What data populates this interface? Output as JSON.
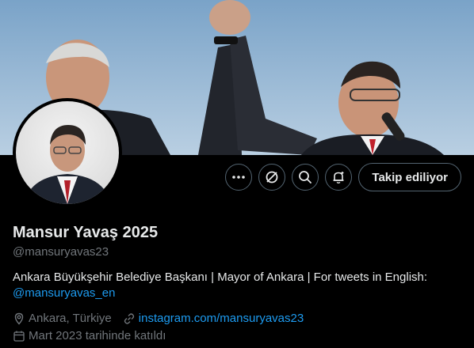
{
  "banner": {
    "description_icon": "banner-photo"
  },
  "profile": {
    "name": "Mansur Yavaş 2025",
    "handle": "@mansuryavas23",
    "bio_text": "Ankara Büyükşehir Belediye Başkanı | Mayor of Ankara | For tweets in English:",
    "bio_link": "@mansuryavas_en",
    "location": "Ankara, Türkiye",
    "website": "instagram.com/mansuryavas23",
    "joined": "Mart 2023 tarihinde katıldı"
  },
  "actions": {
    "more_icon": "more-icon",
    "grok_icon": "grok-icon",
    "search_icon": "search-icon",
    "notify_icon": "notification-bell-icon",
    "follow_label": "Takip ediliyor"
  },
  "colors": {
    "accent": "#1d9bf0",
    "muted": "#71767b",
    "text": "#e7e9ea",
    "border": "#536471"
  }
}
